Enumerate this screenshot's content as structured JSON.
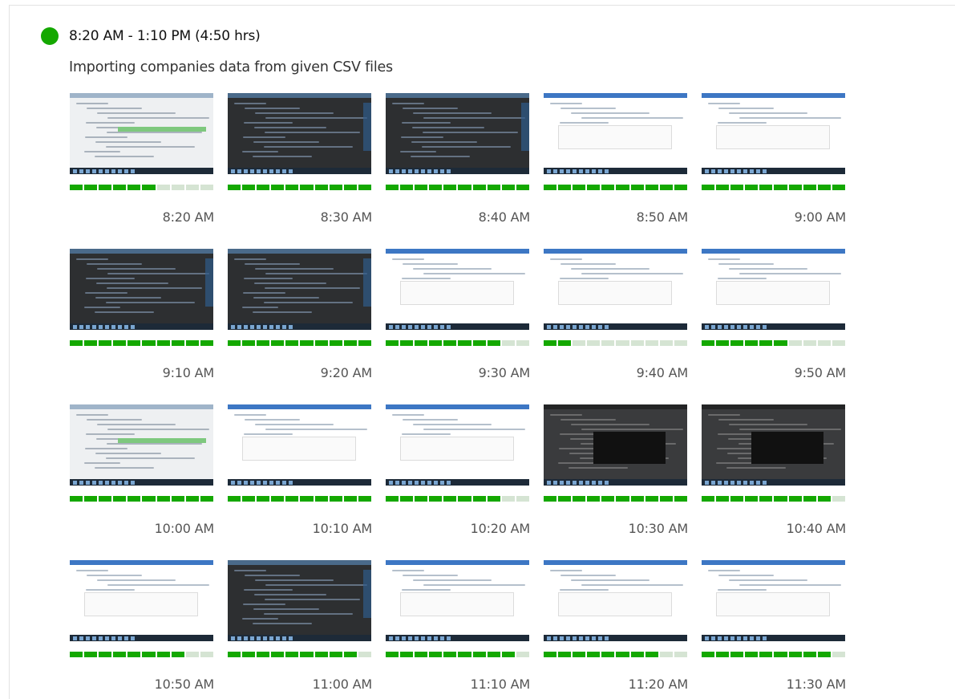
{
  "session": {
    "range": "8:20 AM - 1:10 PM (4:50 hrs)",
    "memo": "Importing companies data from given CSV files",
    "status_color": "#14a800"
  },
  "snapshots": [
    {
      "time": "8:20 AM",
      "theme": "db",
      "activity": 6
    },
    {
      "time": "8:30 AM",
      "theme": "ide",
      "activity": 10
    },
    {
      "time": "8:40 AM",
      "theme": "ide",
      "activity": 10
    },
    {
      "time": "8:50 AM",
      "theme": "web",
      "activity": 10
    },
    {
      "time": "9:00 AM",
      "theme": "web",
      "activity": 10
    },
    {
      "time": "9:10 AM",
      "theme": "ide",
      "activity": 10
    },
    {
      "time": "9:20 AM",
      "theme": "ide",
      "activity": 10
    },
    {
      "time": "9:30 AM",
      "theme": "web",
      "activity": 8
    },
    {
      "time": "9:40 AM",
      "theme": "web",
      "activity": 2
    },
    {
      "time": "9:50 AM",
      "theme": "web",
      "activity": 6
    },
    {
      "time": "10:00 AM",
      "theme": "db",
      "activity": 10
    },
    {
      "time": "10:10 AM",
      "theme": "web",
      "activity": 10
    },
    {
      "time": "10:20 AM",
      "theme": "web",
      "activity": 8
    },
    {
      "time": "10:30 AM",
      "theme": "dark",
      "activity": 10
    },
    {
      "time": "10:40 AM",
      "theme": "dark",
      "activity": 9
    },
    {
      "time": "10:50 AM",
      "theme": "web",
      "activity": 8
    },
    {
      "time": "11:00 AM",
      "theme": "ide",
      "activity": 9
    },
    {
      "time": "11:10 AM",
      "theme": "web",
      "activity": 9
    },
    {
      "time": "11:20 AM",
      "theme": "web",
      "activity": 8
    },
    {
      "time": "11:30 AM",
      "theme": "web",
      "activity": 9
    }
  ]
}
